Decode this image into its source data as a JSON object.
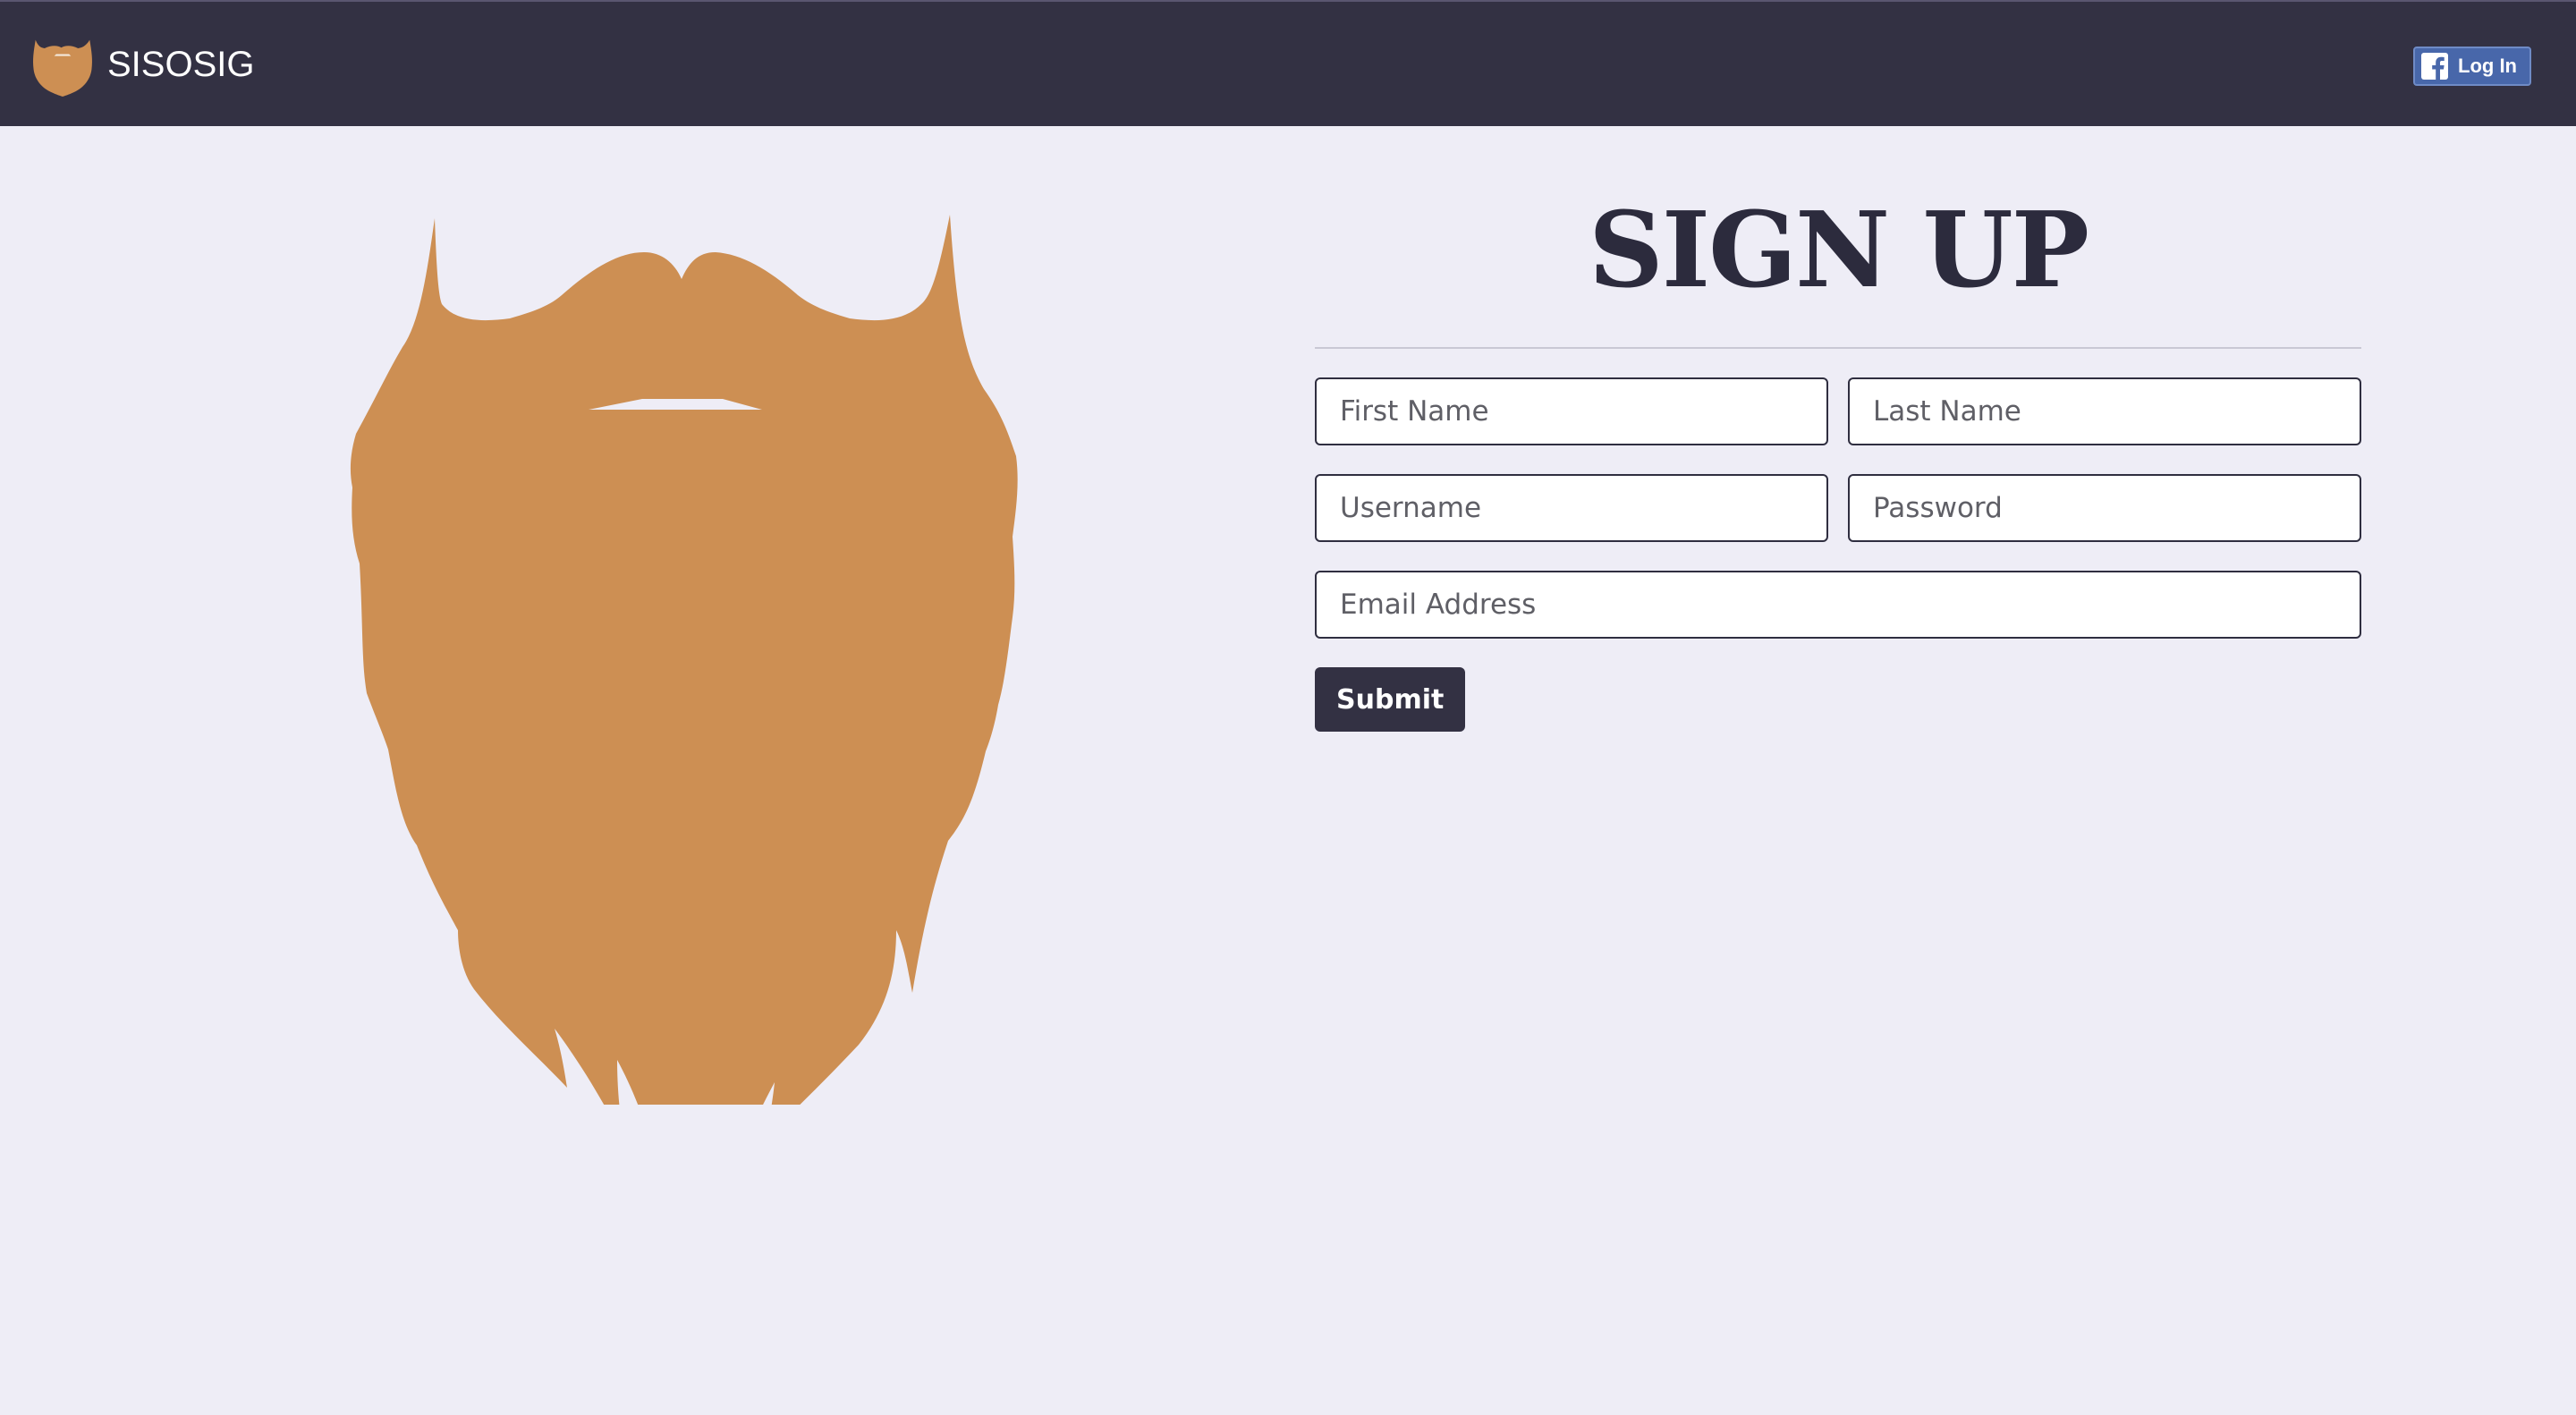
{
  "navbar": {
    "brand_name": "SISOSIG",
    "brand_logo_icon": "beard-icon",
    "fb_login_label": "Log In",
    "fb_icon": "facebook-icon"
  },
  "hero": {
    "illustration_icon": "beard-icon",
    "beard_color": "#cd8f53"
  },
  "signup": {
    "title": "SIGN UP",
    "fields": {
      "first_name": {
        "placeholder": "First Name",
        "value": ""
      },
      "last_name": {
        "placeholder": "Last Name",
        "value": ""
      },
      "username": {
        "placeholder": "Username",
        "value": ""
      },
      "password": {
        "placeholder": "Password",
        "value": ""
      },
      "email": {
        "placeholder": "Email Address",
        "value": ""
      }
    },
    "submit_label": "Submit"
  },
  "colors": {
    "navbar_bg": "#333143",
    "page_bg": "#eeedf6",
    "accent": "#cd8f53",
    "facebook_blue": "#4867aa"
  }
}
